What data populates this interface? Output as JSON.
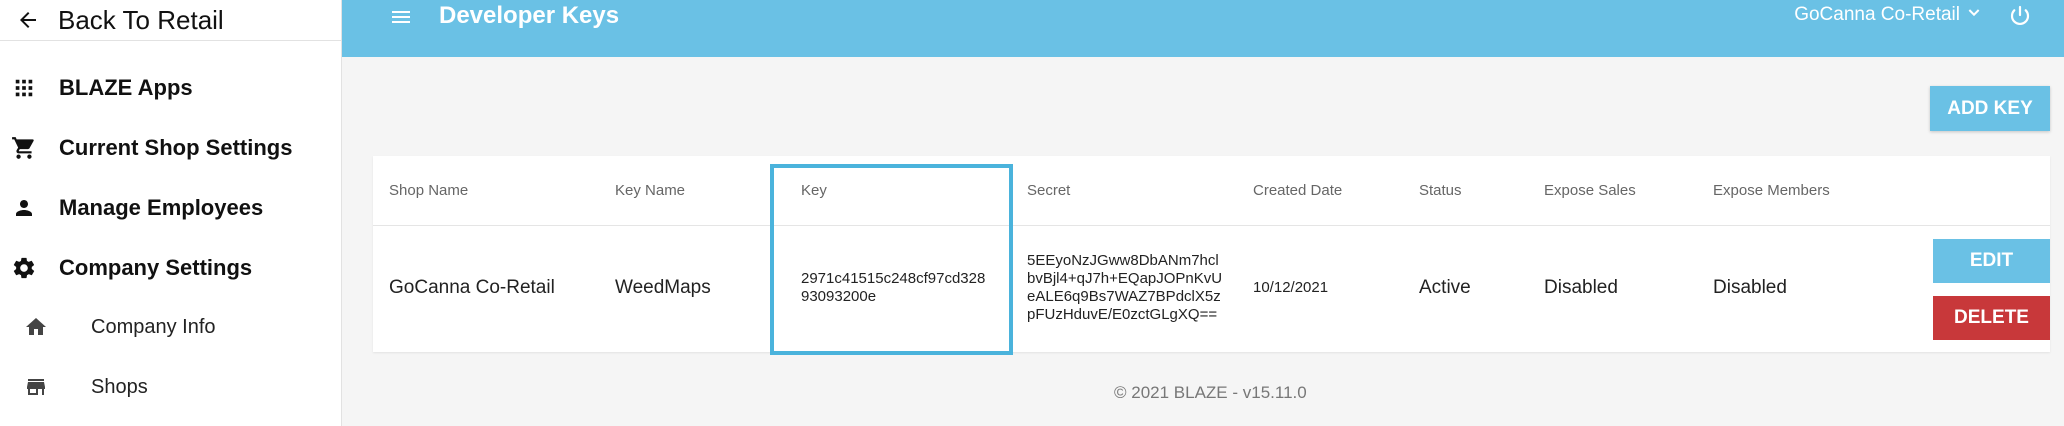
{
  "sidebar": {
    "back_label": "Back To Retail",
    "items": [
      {
        "label": "BLAZE Apps",
        "icon": "apps-grid-icon"
      },
      {
        "label": "Current Shop Settings",
        "icon": "cart-icon"
      },
      {
        "label": "Manage Employees",
        "icon": "person-icon"
      },
      {
        "label": "Company Settings",
        "icon": "gear-icon"
      }
    ],
    "sub_items": [
      {
        "label": "Company Info",
        "icon": "home-icon"
      },
      {
        "label": "Shops",
        "icon": "store-icon"
      }
    ]
  },
  "header": {
    "title": "Developer Keys",
    "account": "GoCanna Co-Retail"
  },
  "actions": {
    "add_key": "ADD KEY"
  },
  "table": {
    "headers": {
      "shop_name": "Shop Name",
      "key_name": "Key Name",
      "key": "Key",
      "secret": "Secret",
      "created_date": "Created Date",
      "status": "Status",
      "expose_sales": "Expose Sales",
      "expose_members": "Expose Members"
    },
    "rows": [
      {
        "shop_name": "GoCanna Co-Retail",
        "key_name": "WeedMaps",
        "key_line1": "2971c41515c248cf97cd328",
        "key_line2": "93093200e",
        "secret_line1": "5EEyoNzJGww8DbANm7hcl",
        "secret_line2": "bvBjl4+qJ7h+EQapJOPnKvU",
        "secret_line3": "eALE6q9Bs7WAZ7BPdclX5z",
        "secret_line4": "pFUzHduvE/E0zctGLgXQ==",
        "created_date": "10/12/2021",
        "status": "Active",
        "expose_sales": "Disabled",
        "expose_members": "Disabled",
        "edit_label": "EDIT",
        "delete_label": "DELETE"
      }
    ]
  },
  "footer": "© 2021 BLAZE - v15.11.0",
  "colors": {
    "accent": "#6ac1e5",
    "danger": "#c8383a",
    "highlight": "#4ab3dc"
  }
}
